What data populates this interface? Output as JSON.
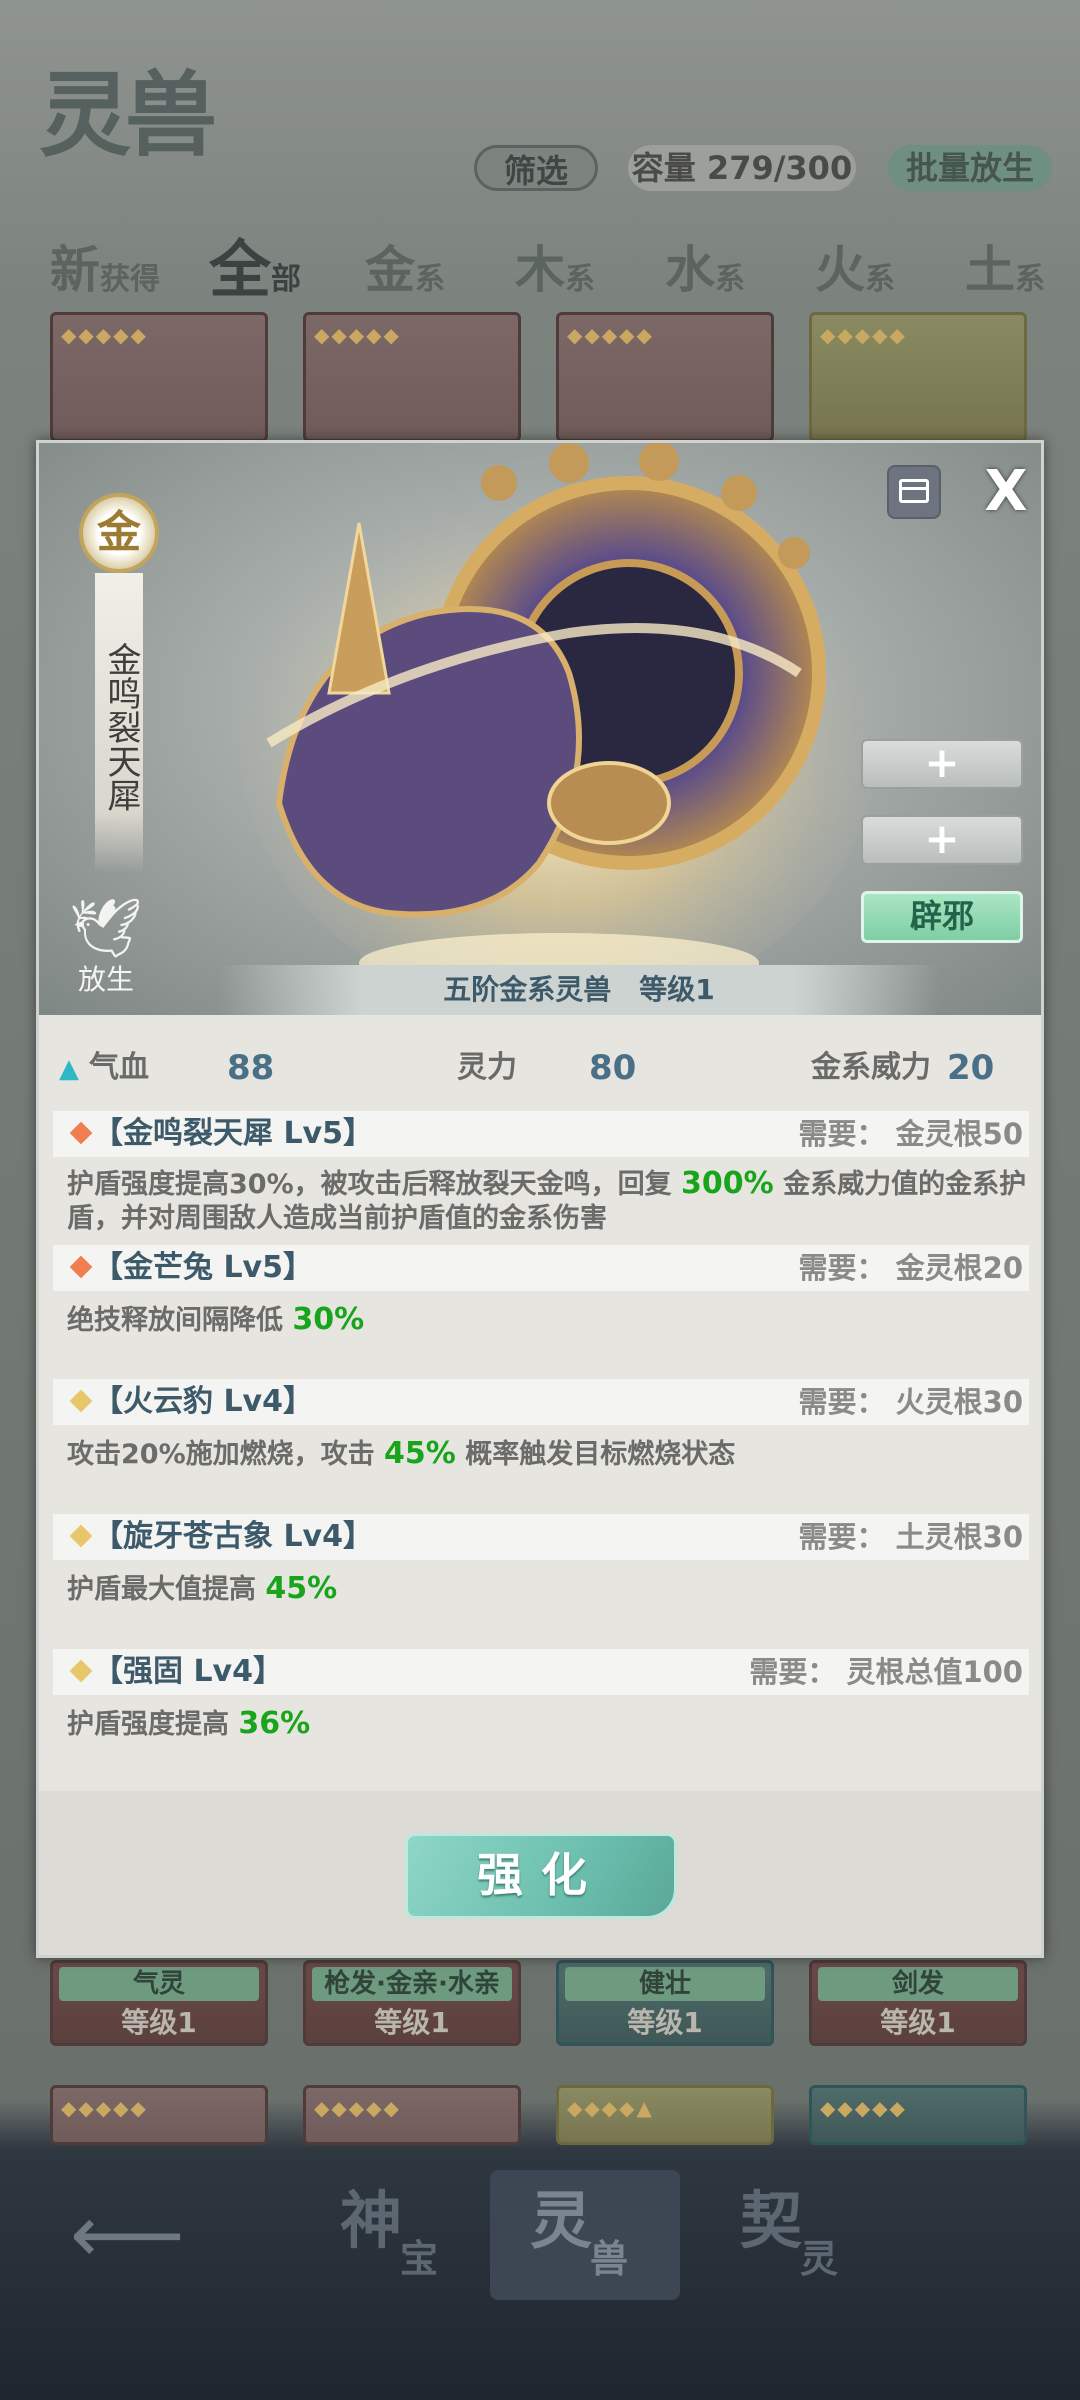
{
  "header": {
    "title": "灵兽",
    "filter_label": "筛选",
    "capacity_label": "容量 279/300",
    "batch_release_label": "批量放生"
  },
  "tabs": [
    {
      "big": "新",
      "small": "获得"
    },
    {
      "big": "全",
      "small": "部"
    },
    {
      "big": "金",
      "small": "系"
    },
    {
      "big": "木",
      "small": "系"
    },
    {
      "big": "水",
      "small": "系"
    },
    {
      "big": "火",
      "small": "系"
    },
    {
      "big": "土",
      "small": "系"
    }
  ],
  "cards_row2": [
    {
      "name": "气灵",
      "level": "等级1"
    },
    {
      "name": "枪发·金亲·水亲",
      "level": "等级1"
    },
    {
      "name": "健壮",
      "level": "等级1"
    },
    {
      "name": "剑发",
      "level": "等级1"
    }
  ],
  "nav": {
    "items": [
      {
        "big": "神",
        "small": "宝"
      },
      {
        "big": "灵",
        "small": "兽"
      },
      {
        "big": "契",
        "small": "灵"
      }
    ]
  },
  "modal": {
    "element": "金",
    "beast_name": "金鸣裂天犀",
    "release_label": "放生",
    "slot_plus_1": "+",
    "slot_plus_2": "+",
    "equipped_label": "辟邪",
    "caption": "五阶金系灵兽　等级1",
    "stats": {
      "hp_label": "气血",
      "hp_value": "88",
      "sp_label": "灵力",
      "sp_value": "80",
      "power_label": "金系威力",
      "power_value": "20"
    },
    "skills": [
      {
        "name": "【金鸣裂天犀 Lv5】",
        "req": "需要：  金灵根50",
        "color": "#ef7f4e",
        "desc_before": "护盾强度提高30%，被攻击后释放裂天金鸣，回复 ",
        "highlight": "300%",
        "desc_after": " 金系威力值的金系护盾，并对周围敌人造成当前护盾值的金系伤害"
      },
      {
        "name": "【金芒兔 Lv5】",
        "req": "需要：  金灵根20",
        "color": "#ef7f4e",
        "desc_before": "绝技释放间隔降低 ",
        "highlight": "30%",
        "desc_after": ""
      },
      {
        "name": "【火云豹 Lv4】",
        "req": "需要：  火灵根30",
        "color": "#e8c66a",
        "desc_before": "攻击20%施加燃烧，攻击 ",
        "highlight": "45%",
        "desc_after": " 概率触发目标燃烧状态"
      },
      {
        "name": "【旋牙苍古象 Lv4】",
        "req": "需要：  土灵根30",
        "color": "#e8c66a",
        "desc_before": "护盾最大值提高 ",
        "highlight": "45%",
        "desc_after": ""
      },
      {
        "name": "【强固 Lv4】",
        "req": "需要：  灵根总值100",
        "color": "#e8c66a",
        "desc_before": "护盾强度提高 ",
        "highlight": "36%",
        "desc_after": ""
      }
    ],
    "upgrade_label": "强化"
  },
  "colors": {
    "accent_teal": "#6cbfae",
    "highlight_green": "#18a51b",
    "stat_value_blue": "#4a7088",
    "diamond_orange": "#ef7f4e",
    "diamond_gold": "#e8c66a"
  }
}
